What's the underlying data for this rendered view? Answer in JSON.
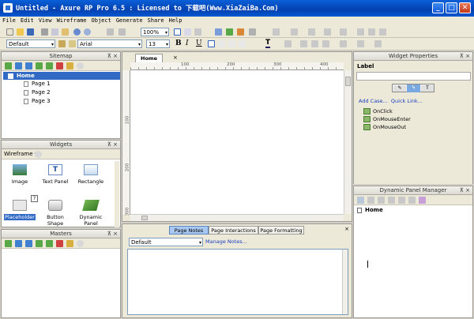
{
  "window": {
    "title": "Untitled - Axure RP Pro 6.5 : Licensed to 下载吧(Www.XiaZaiBa.Com)",
    "min_label": "_",
    "max_label": "□",
    "close_label": "✕"
  },
  "menu": [
    "File",
    "Edit",
    "View",
    "Wireframe",
    "Object",
    "Generate",
    "Share",
    "Help"
  ],
  "toolbar": {
    "zoom": "100%",
    "style": "Default",
    "font": "Arial",
    "size": "13",
    "bold": "B",
    "italic": "I",
    "underline": "U",
    "text_color": "T"
  },
  "sitemap": {
    "title": "Sitemap",
    "root": "Home",
    "pages": [
      "Page 1",
      "Page 2",
      "Page 3"
    ]
  },
  "widgets": {
    "title": "Widgets",
    "library": "Wireframe",
    "items": [
      "Image",
      "Text Panel",
      "Rectangle",
      "Placeholder",
      "Button Shape",
      "Dynamic Panel"
    ],
    "help_badge": "?"
  },
  "masters": {
    "title": "Masters"
  },
  "canvas": {
    "tab": "Home",
    "tab_close": "×",
    "ruler_h": [
      "100",
      "200",
      "300",
      "400"
    ],
    "ruler_v": [
      "100",
      "200",
      "300"
    ]
  },
  "page_notes": {
    "tabs": [
      "Page Notes",
      "Page Interactions",
      "Page Formatting"
    ],
    "select": "Default",
    "manage": "Manage Notes..."
  },
  "widget_properties": {
    "title": "Widget Properties",
    "label_heading": "Label",
    "add_case": "Add Case...",
    "quick_link": "Quick Link...",
    "events": [
      "OnClick",
      "OnMouseEnter",
      "OnMouseOut"
    ]
  },
  "dynamic_panel_manager": {
    "title": "Dynamic Panel Manager",
    "item": "Home"
  },
  "panel_close": "×",
  "panel_pin": "⊼"
}
